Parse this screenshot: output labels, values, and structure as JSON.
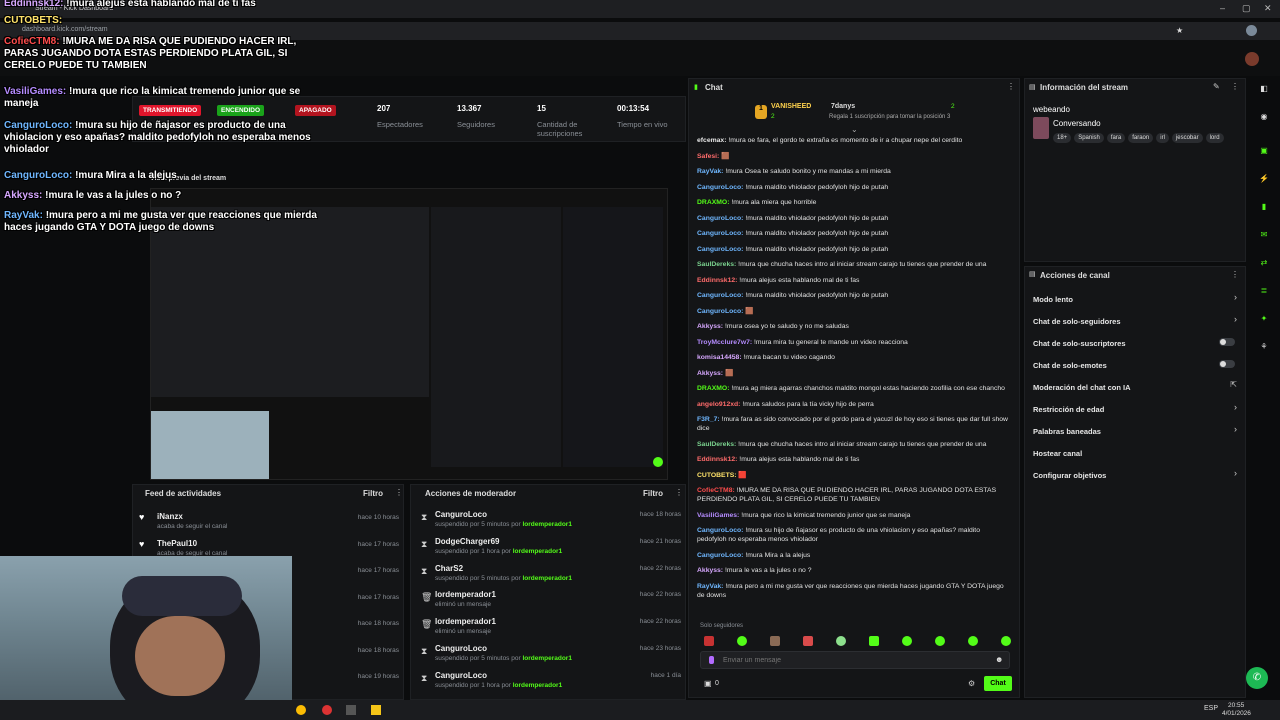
{
  "browser": {
    "tab_title": "Stream - Kick Dashboard",
    "url": "dashboard.kick.com/stream",
    "tray": {
      "lang": "ESP",
      "time": "20:55",
      "date": "4/01/2026"
    }
  },
  "overlay_chat": [
    {
      "user": "Eddinnsk12:",
      "text": " !mura alejus esta hablando mal de ti fas",
      "color": "#d7a8ff"
    },
    {
      "user": "CUTOBETS:",
      "text": "",
      "color": "#ffe36a"
    },
    {
      "user": "CofieCTM8:",
      "text": " !MURA ME DA RISA QUE PUDIENDO HACER IRL, PARAS JUGANDO DOTA ESTAS PERDIENDO PLATA GIL, SI CERELO PUEDE TU TAMBIEN",
      "color": "#ff4d4d"
    },
    {
      "user": "VasiliGames:",
      "text": " !mura que rico la kimicat tremendo junior que se maneja",
      "color": "#b58cff"
    },
    {
      "user": "CanguroLoco:",
      "text": " !mura su hijo de ñajasor es producto de una vhiolacion y eso apañas? maldito pedofyloh no esperaba menos vhiolador",
      "color": "#6fb7ff"
    },
    {
      "user": "CanguroLoco:",
      "text": " !mura Mira a la alejus",
      "color": "#6fb7ff"
    },
    {
      "user": "Akkyss:",
      "text": " !mura le vas a la jules o no ?",
      "color": "#d7a8ff"
    },
    {
      "user": "RayVak:",
      "text": " !mura pero a mi me gusta ver que reacciones que mierda haces jugando GTA Y DOTA juego de downs",
      "color": "#6fb7ff"
    }
  ],
  "sidebar_menu": [
    "Información de la sesión",
    "Publicación",
    "Multistream",
    "Drops y recompensas",
    "Estudio",
    "Canal",
    "Ajustes"
  ],
  "session": {
    "badges": [
      "TRANSMITIENDO",
      "ENCENDIDO",
      "APAGADO"
    ],
    "stats": [
      {
        "value": "207",
        "label": "Espectadores"
      },
      {
        "value": "13.367",
        "label": "Seguidores"
      },
      {
        "value": "15",
        "label": "Cantidad de suscripciones"
      },
      {
        "value": "00:13:54",
        "label": "Tiempo en vivo"
      }
    ],
    "preview_title": "Vista previa del stream"
  },
  "feed": {
    "title": "Feed de actividades",
    "filter": "Filtro",
    "items": [
      {
        "name": "iNanzx",
        "sub": "acaba de seguir el canal",
        "time": "hace 10 horas"
      },
      {
        "name": "ThePaul10",
        "sub": "acaba de seguir el canal",
        "time": "hace 17 horas"
      },
      {
        "name": "",
        "sub": "",
        "time": "hace 17 horas"
      },
      {
        "name": "",
        "sub": "",
        "time": "hace 17 horas"
      },
      {
        "name": "",
        "sub": "",
        "time": "hace 18 horas"
      },
      {
        "name": "",
        "sub": "",
        "time": "hace 18 horas"
      },
      {
        "name": "",
        "sub": "",
        "time": "hace 19 horas"
      }
    ]
  },
  "mod": {
    "title": "Acciones de moderador",
    "filter": "Filtro",
    "items": [
      {
        "name": "CanguroLoco",
        "sub": "suspendido por 5 minutos por",
        "by": "lordemperador1",
        "time": "hace 18 horas",
        "icon": "⧗"
      },
      {
        "name": "DodgeCharger69",
        "sub": "suspendido por 1 hora por",
        "by": "lordemperador1",
        "time": "hace 21 horas",
        "icon": "⧗"
      },
      {
        "name": "CharS2",
        "sub": "suspendido por 5 minutos por",
        "by": "lordemperador1",
        "time": "hace 22 horas",
        "icon": "⧗"
      },
      {
        "name": "lordemperador1",
        "sub": "eliminó un mensaje",
        "by": "",
        "time": "hace 22 horas",
        "icon": "🗑"
      },
      {
        "name": "lordemperador1",
        "sub": "eliminó un mensaje",
        "by": "",
        "time": "hace 22 horas",
        "icon": "🗑"
      },
      {
        "name": "CanguroLoco",
        "sub": "suspendido por 5 minutos por",
        "by": "lordemperador1",
        "time": "hace 23 horas",
        "icon": "⧗"
      },
      {
        "name": "CanguroLoco",
        "sub": "suspendido por 1 hora por",
        "by": "lordemperador1",
        "time": "hace 1 día",
        "icon": "⧗"
      }
    ]
  },
  "chat": {
    "title": "Chat",
    "top_gifter": "VANISHEED",
    "top_gifter_count": "2",
    "second_user": "7danys",
    "second_count": "2",
    "gift_note": "Regala 1 suscripción para tomar la posición 3",
    "messages": [
      {
        "user": "efcemax:",
        "text": " !mura oe fara, el gordo te extraña es momento de ir a chupar nepe del cerdito",
        "color": "#e6e6e6"
      },
      {
        "user": "Safesi:",
        "text": " 🟫",
        "color": "#ff6b6b"
      },
      {
        "user": "RayVak:",
        "text": " !mura Osea te saludo bonito y me mandas a mi mierda",
        "color": "#6fb7ff"
      },
      {
        "user": "CanguroLoco:",
        "text": " !mura maldito vhiolador pedofyloh hijo de putah",
        "color": "#6fb7ff"
      },
      {
        "user": "DRAXMO:",
        "text": " !mura ala miera que horrible",
        "color": "#53fc18"
      },
      {
        "user": "CanguroLoco:",
        "text": " !mura maldito vhiolador pedofyloh hijo de putah",
        "color": "#6fb7ff"
      },
      {
        "user": "CanguroLoco:",
        "text": " !mura maldito vhiolador pedofyloh hijo de putah",
        "color": "#6fb7ff"
      },
      {
        "user": "CanguroLoco:",
        "text": " !mura maldito vhiolador pedofyloh hijo de putah",
        "color": "#6fb7ff"
      },
      {
        "user": "SaulDereks:",
        "text": " !mura que chucha haces intro al iniciar stream carajo tu tienes que prender de una",
        "color": "#7bd38f"
      },
      {
        "user": "Eddinnsk12:",
        "text": " !mura alejus esta hablando mal de ti fas",
        "color": "#ff6b6b"
      },
      {
        "user": "CanguroLoco:",
        "text": " !mura maldito vhiolador pedofyloh hijo de putah",
        "color": "#6fb7ff"
      },
      {
        "user": "CanguroLoco:",
        "text": " 🟫",
        "color": "#6fb7ff"
      },
      {
        "user": "Akkyss:",
        "text": " !mura osea yo te saludo y no me saludas",
        "color": "#d7a8ff"
      },
      {
        "user": "TroyMcclure7w7:",
        "text": " !mura mira tu general te mande un video reacciona",
        "color": "#b58cff"
      },
      {
        "user": "komisa14458:",
        "text": " !mura bacan tu video cagando",
        "color": "#d7a8ff"
      },
      {
        "user": "Akkyss:",
        "text": " 🟫",
        "color": "#d7a8ff"
      },
      {
        "user": "DRAXMO:",
        "text": " !mura ag miera agarras chanchos maldito mongol estas haciendo zoofilia con ese chancho",
        "color": "#53fc18"
      },
      {
        "user": "angelo912xd:",
        "text": " !mura saludos para la tía vicky hijo de perra",
        "color": "#ff6b6b"
      },
      {
        "user": "F3R_7:",
        "text": " !mura fara as sido convocado por el gordo para el yacuzl de hoy eso si tienes que dar full show dice",
        "color": "#6fb7ff"
      },
      {
        "user": "SaulDereks:",
        "text": " !mura que chucha haces intro al iniciar stream carajo tu tienes que prender de una",
        "color": "#7bd38f"
      },
      {
        "user": "Eddinnsk12:",
        "text": " !mura alejus esta hablando mal de ti fas",
        "color": "#ff6b6b"
      },
      {
        "user": "CUTOBETS:",
        "text": " 🟥",
        "color": "#ffe36a"
      },
      {
        "user": "CofieCTM8:",
        "text": " !MURA ME DA RISA QUE PUDIENDO HACER IRL, PARAS JUGANDO DOTA ESTAS PERDIENDO PLATA GIL, SI CERELO PUEDE TU TAMBIEN",
        "color": "#ff4d4d"
      },
      {
        "user": "VasiliGames:",
        "text": " !mura que rico la kimicat tremendo junior que se maneja",
        "color": "#b58cff"
      },
      {
        "user": "CanguroLoco:",
        "text": " !mura su hijo de ñajasor es producto de una vhiolacion y eso apañas? maldito pedofyloh no esperaba menos vhiolador",
        "color": "#6fb7ff"
      },
      {
        "user": "CanguroLoco:",
        "text": " !mura Mira a la alejus",
        "color": "#6fb7ff"
      },
      {
        "user": "Akkyss:",
        "text": " !mura le vas a la jules o no ?",
        "color": "#d7a8ff"
      },
      {
        "user": "RayVak:",
        "text": " !mura pero a mi me gusta ver que reacciones que mierda haces jugando GTA Y DOTA juego de downs",
        "color": "#6fb7ff"
      }
    ],
    "followers_only": "Solo seguidores",
    "input_placeholder": "Enviar un mensaje",
    "points": "0",
    "send_label": "Chat"
  },
  "stream_info": {
    "title": "Información del stream",
    "stream_title": "webeando",
    "category": "Conversando",
    "tags": [
      "18+",
      "Spanish",
      "fara",
      "faraon",
      "irl",
      "jescobar",
      "lord"
    ]
  },
  "channel_actions": {
    "title": "Acciones de canal",
    "items": [
      {
        "label": "Modo lento",
        "control": "chevron"
      },
      {
        "label": "Chat de solo-seguidores",
        "control": "chevron"
      },
      {
        "label": "Chat de solo-suscriptores",
        "control": "toggle"
      },
      {
        "label": "Chat de solo-emotes",
        "control": "toggle"
      },
      {
        "label": "Moderación del chat con IA",
        "control": "external"
      },
      {
        "label": "Restricción de edad",
        "control": "chevron"
      },
      {
        "label": "Palabras baneadas",
        "control": "chevron"
      },
      {
        "label": "Hostear canal",
        "control": "none"
      },
      {
        "label": "Configurar objetivos",
        "control": "chevron"
      }
    ]
  },
  "colors": {
    "kick_green": "#53fc18",
    "live_red": "#e0152b",
    "bg": "#0b0c0d",
    "panel": "#141517"
  }
}
